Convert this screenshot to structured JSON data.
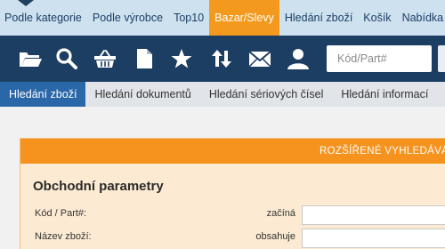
{
  "top_nav": {
    "items": [
      {
        "label": "Podle kategorie",
        "active": false
      },
      {
        "label": "Podle výrobce",
        "active": false
      },
      {
        "label": "Top10",
        "active": false
      },
      {
        "label": "Bazar/Slevy",
        "active": true
      },
      {
        "label": "Hledání zboží",
        "active": false
      },
      {
        "label": "Košík",
        "active": false
      },
      {
        "label": "Nabídka",
        "active": false
      }
    ]
  },
  "toolbar": {
    "icons": [
      "folder-icon",
      "search-icon",
      "basket-icon",
      "document-icon",
      "star-icon",
      "sort-arrows-icon",
      "envelope-icon",
      "user-icon"
    ],
    "code_placeholder": "Kód/Part#"
  },
  "tabs": [
    {
      "label": "Hledání zboží",
      "active": true
    },
    {
      "label": "Hledání dokumentů",
      "active": false
    },
    {
      "label": "Hledání sériových čísel",
      "active": false
    },
    {
      "label": "Hledání informací",
      "active": false
    }
  ],
  "panel": {
    "header": "ROZŠÍŘENÉ VYHLEDÁVÁNÍ",
    "title": "Obchodní parametry",
    "rows": [
      {
        "label": "Kód / Part#:",
        "operator": "začíná"
      },
      {
        "label": "Název zboží:",
        "operator": "obsahuje"
      }
    ]
  },
  "colors": {
    "top_nav_bg": "#cde1ef",
    "accent_orange": "#f39a1e",
    "toolbar_bg": "#1d3e63",
    "active_tab": "#2a67a8",
    "panel_bg": "#fcebd2"
  }
}
